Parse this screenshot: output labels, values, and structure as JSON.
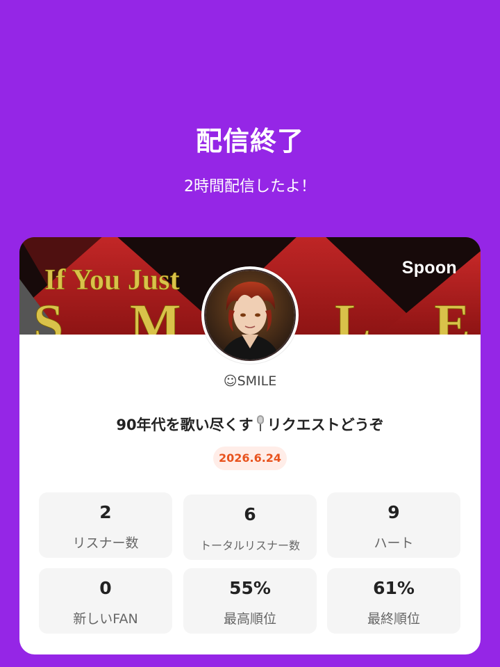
{
  "header": {
    "title": "配信終了",
    "subtitle": "2時間配信したよ！"
  },
  "card": {
    "brand": "Spoon",
    "banner_text_1": "If You Just",
    "banner_text_2": "S M I L E",
    "username": "☺SMILE",
    "live_title_part1": "90年代を歌い尽くす",
    "live_title_icon": "microphone-icon",
    "live_title_part2": "リクエストどうぞ",
    "date": "2026.6.24"
  },
  "stats": [
    {
      "value": "2",
      "label": "リスナー数"
    },
    {
      "value": "6",
      "label": "トータルリスナー数"
    },
    {
      "value": "9",
      "label": "ハート"
    },
    {
      "value": "0",
      "label": "新しいFAN"
    },
    {
      "value": "55%",
      "label": "最高順位"
    },
    {
      "value": "61%",
      "label": "最終順位"
    }
  ],
  "colors": {
    "background": "#9526E6",
    "date_badge_text": "#E8531E",
    "date_badge_bg": "#FFEDE8"
  }
}
